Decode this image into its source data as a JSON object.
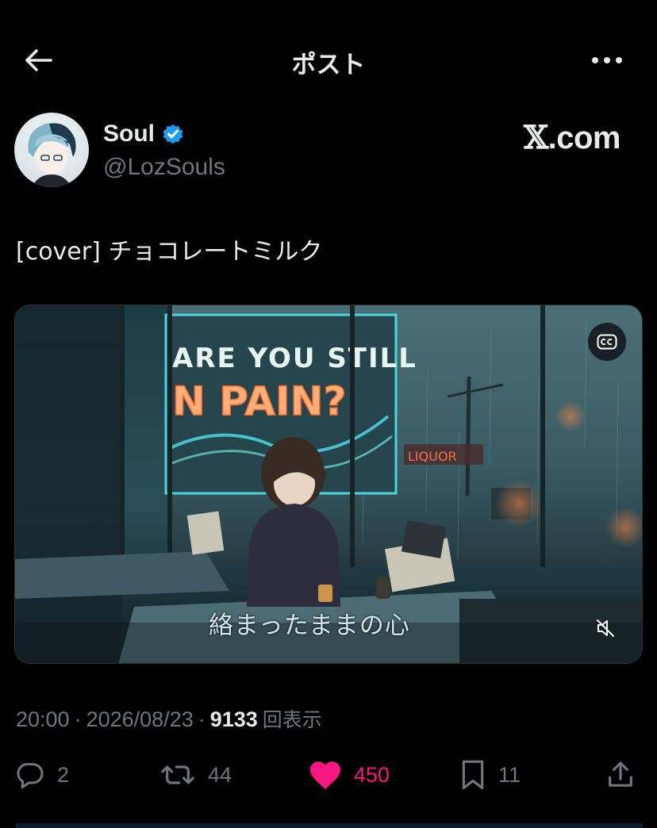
{
  "header": {
    "title": "ポスト",
    "back_icon": "arrow-left-icon",
    "more_icon": "more-horizontal-icon"
  },
  "author": {
    "display_name": "Soul",
    "handle": "@LozSouls",
    "verified": true,
    "verified_color": "#1d9bf0"
  },
  "watermark": {
    "x": "𝕏",
    "domain": ".com"
  },
  "post": {
    "text": "[cover] チョコレートミルク"
  },
  "media": {
    "sign_line1": "ARE YOU STILL",
    "sign_line2": "N PAIN?",
    "liquor_sign": "LIQUOR",
    "subtitle": "絡まったままの心",
    "cc_icon": "closed-captions-icon",
    "mute_icon": "volume-muted-icon"
  },
  "meta": {
    "time": "20:00",
    "sep1": "·",
    "date": "2026/08/23",
    "sep2": "·",
    "views": "9133",
    "views_label": "回表示"
  },
  "actions": {
    "reply": {
      "icon": "reply-icon",
      "count": "2"
    },
    "repost": {
      "icon": "repost-icon",
      "count": "44"
    },
    "like": {
      "icon": "heart-icon",
      "count": "450",
      "color": "#f91880",
      "liked": true
    },
    "bookmark": {
      "icon": "bookmark-icon",
      "count": "11"
    },
    "share": {
      "icon": "share-icon"
    }
  },
  "colors": {
    "background": "#000000",
    "text": "#e7e9ea",
    "muted": "#71767b",
    "accent": "#1d9bf0",
    "like": "#f91880"
  }
}
